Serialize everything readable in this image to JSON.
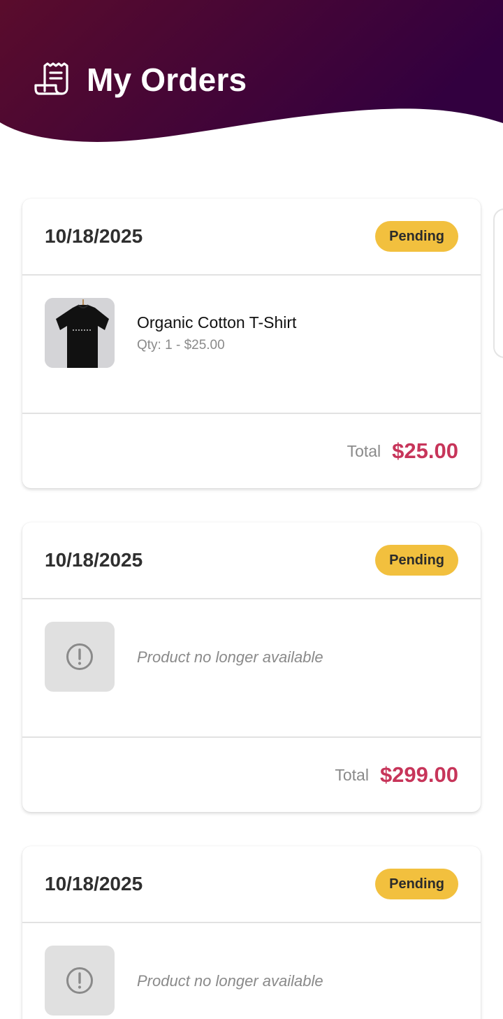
{
  "header": {
    "title": "My Orders",
    "icon": "receipt-icon",
    "gradient_start": "#5a0c2c",
    "gradient_end": "#32003f"
  },
  "orders": [
    {
      "date": "10/18/2025",
      "status": "Pending",
      "product_name": "Organic Cotton T-Shirt",
      "product_qty": "Qty: 1 - $25.00",
      "total_label": "Total",
      "total": "$25.00"
    },
    {
      "date": "10/18/2025",
      "status": "Pending",
      "unavailable_text": "Product no longer available",
      "total_label": "Total",
      "total": "$299.00"
    },
    {
      "date": "10/18/2025",
      "status": "Pending",
      "unavailable_text": "Product no longer available"
    }
  ],
  "colors": {
    "status_pending": "#f2c03e",
    "total_accent": "#c7355a"
  }
}
